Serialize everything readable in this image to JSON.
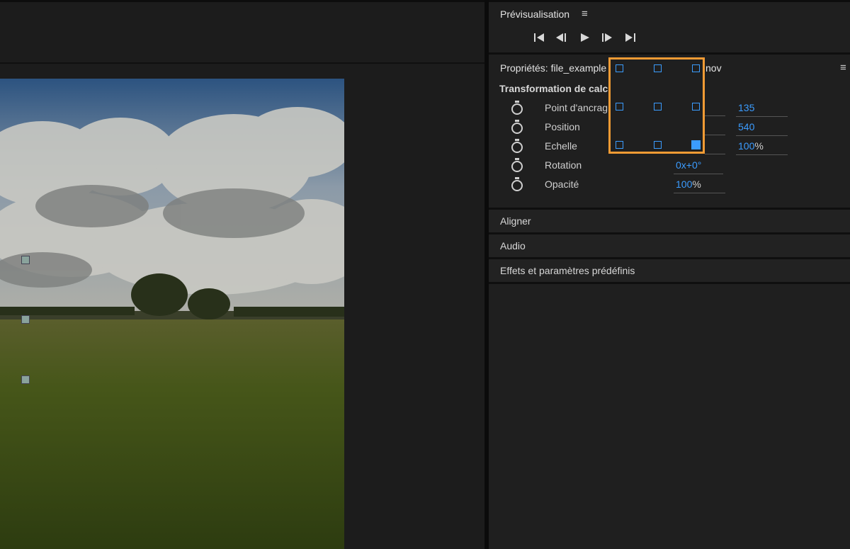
{
  "preview": {
    "title": "Prévisualisation",
    "menu_icon": "≡",
    "controls": [
      {
        "name": "go-to-start",
        "glyph": "|◀"
      },
      {
        "name": "step-back",
        "glyph": "◀|"
      },
      {
        "name": "play",
        "glyph": "▶"
      },
      {
        "name": "step-forward",
        "glyph": "|▶"
      },
      {
        "name": "go-to-end",
        "glyph": "▶|"
      }
    ]
  },
  "properties": {
    "title_left": "Propriétés: file_example",
    "title_right": "nov",
    "menu_icon": "≡",
    "section": "Transformation de calc",
    "rows": [
      {
        "label": "Point d'ancrag",
        "value": "135",
        "suffix": ""
      },
      {
        "label": "Position",
        "value": "540",
        "suffix": ""
      },
      {
        "label": "Echelle",
        "value": "100",
        "suffix": "%"
      },
      {
        "label": "Rotation",
        "value": "0x+0°",
        "suffix": ""
      },
      {
        "label": "Opacité",
        "value": "100",
        "suffix": "%"
      }
    ],
    "anchor_grid_selected": "bottom-right"
  },
  "panels": {
    "align": "Aligner",
    "audio": "Audio",
    "effects": "Effets et paramètres prédéfinis"
  },
  "colors": {
    "accent": "#3b9cff",
    "highlight": "#f29b34"
  }
}
